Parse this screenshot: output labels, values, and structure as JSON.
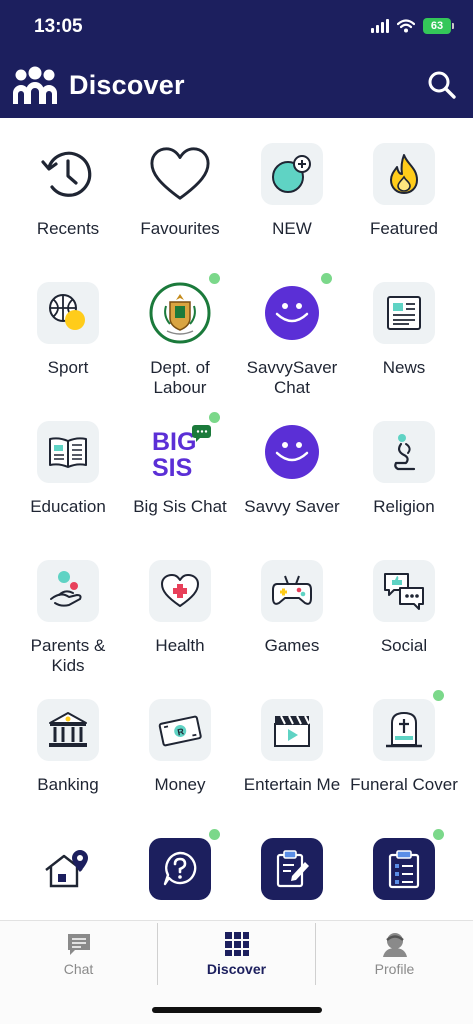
{
  "status_bar": {
    "time": "13:05",
    "battery": "63"
  },
  "header": {
    "title": "Discover"
  },
  "colors": {
    "navy": "#1c1f5e",
    "new_dot": "#7bd88a",
    "tile_bg": "#eef2f4",
    "purple": "#5b2fd6"
  },
  "tiles": [
    {
      "label": "Recents",
      "icon": "clock-history-icon",
      "dot": false
    },
    {
      "label": "Favourites",
      "icon": "heart-icon",
      "dot": false
    },
    {
      "label": "NEW",
      "icon": "new-bubble-icon",
      "dot": false
    },
    {
      "label": "Featured",
      "icon": "flame-icon",
      "dot": false
    },
    {
      "label": "Sport",
      "icon": "basketball-icon",
      "dot": false
    },
    {
      "label": "Dept. of Labour",
      "icon": "coat-of-arms-icon",
      "dot": true
    },
    {
      "label": "SavvySaver Chat",
      "icon": "savvy-saver-logo",
      "dot": true
    },
    {
      "label": "News",
      "icon": "newspaper-icon",
      "dot": false
    },
    {
      "label": "Education",
      "icon": "open-book-icon",
      "dot": false
    },
    {
      "label": "Big Sis Chat",
      "icon": "big-sis-logo",
      "dot": true
    },
    {
      "label": "Savvy Saver",
      "icon": "savvy-saver-logo",
      "dot": false
    },
    {
      "label": "Religion",
      "icon": "praying-icon",
      "dot": false
    },
    {
      "label": "Parents & Kids",
      "icon": "parent-child-icon",
      "dot": false
    },
    {
      "label": "Health",
      "icon": "health-heart-icon",
      "dot": false
    },
    {
      "label": "Games",
      "icon": "gamepad-icon",
      "dot": false
    },
    {
      "label": "Social",
      "icon": "chat-bubbles-icon",
      "dot": false
    },
    {
      "label": "Banking",
      "icon": "bank-icon",
      "dot": false
    },
    {
      "label": "Money",
      "icon": "banknote-icon",
      "dot": false
    },
    {
      "label": "Entertain Me",
      "icon": "clapperboard-icon",
      "dot": false
    },
    {
      "label": "Funeral Cover",
      "icon": "gravestone-icon",
      "dot": true
    },
    {
      "label": "",
      "icon": "house-location-icon",
      "dot": false
    },
    {
      "label": "",
      "icon": "question-bubble-icon",
      "dot": true
    },
    {
      "label": "",
      "icon": "clipboard-pen-icon",
      "dot": false
    },
    {
      "label": "",
      "icon": "checklist-icon",
      "dot": true
    }
  ],
  "tabs": [
    {
      "label": "Chat",
      "icon": "chat-icon",
      "active": false
    },
    {
      "label": "Discover",
      "icon": "grid-icon",
      "active": true
    },
    {
      "label": "Profile",
      "icon": "profile-icon",
      "active": false
    }
  ]
}
